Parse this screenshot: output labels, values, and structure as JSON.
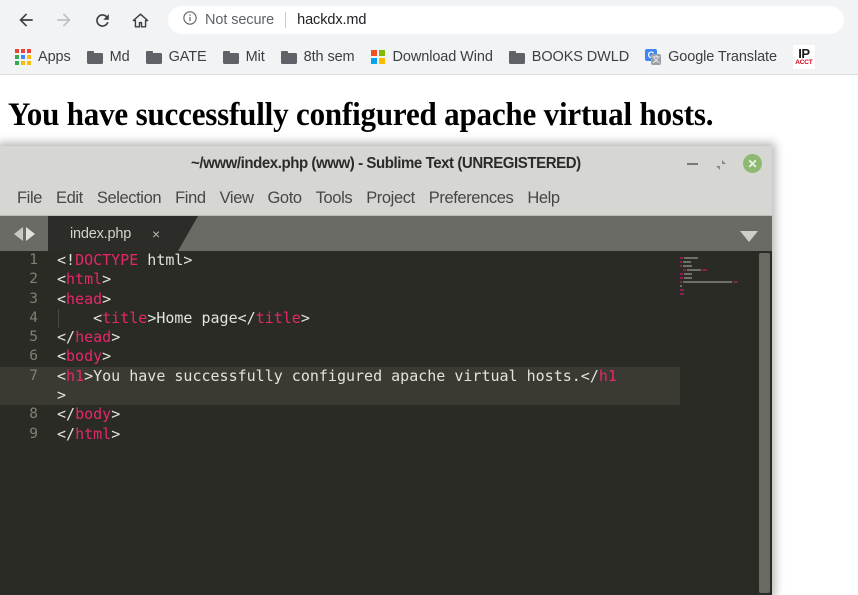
{
  "browser": {
    "toolbar": {
      "back_icon": "back-arrow-icon",
      "forward_icon": "forward-arrow-icon",
      "reload_icon": "reload-icon",
      "home_icon": "home-icon",
      "security_icon": "info-circle-icon",
      "security_label": "Not secure",
      "url": "hackdx.md"
    },
    "bookmarks": [
      {
        "label": "Apps",
        "icon": "apps-grid-icon"
      },
      {
        "label": "Md",
        "icon": "folder-icon"
      },
      {
        "label": "GATE",
        "icon": "folder-icon"
      },
      {
        "label": "Mit",
        "icon": "folder-icon"
      },
      {
        "label": "8th sem",
        "icon": "folder-icon"
      },
      {
        "label": "Download Wind",
        "icon": "windows-logo-icon"
      },
      {
        "label": "BOOKS DWLD",
        "icon": "folder-icon"
      },
      {
        "label": "Google Translate",
        "icon": "google-translate-icon"
      },
      {
        "label": "",
        "icon": "ip-acct-icon"
      }
    ]
  },
  "page": {
    "heading": "You have successfully configured apache virtual hosts."
  },
  "sublime": {
    "title": "~/www/index.php (www) - Sublime Text (UNREGISTERED)",
    "window_controls": {
      "minimize": "minimize-icon",
      "maximize": "maximize-icon",
      "close": "close-icon",
      "close_glyph": "✕"
    },
    "menu": [
      "File",
      "Edit",
      "Selection",
      "Find",
      "View",
      "Goto",
      "Tools",
      "Project",
      "Preferences",
      "Help"
    ],
    "tabs": [
      {
        "label": "index.php",
        "close_glyph": "×",
        "active": true
      }
    ],
    "editor": {
      "lines": [
        {
          "number": "1",
          "active": false,
          "indent_guide": false,
          "tokens": [
            {
              "t": "<!",
              "c": "punc"
            },
            {
              "t": "DOCTYPE",
              "c": "tag"
            },
            {
              "t": " html>",
              "c": "punc"
            }
          ]
        },
        {
          "number": "2",
          "active": false,
          "indent_guide": false,
          "tokens": [
            {
              "t": "<",
              "c": "punc"
            },
            {
              "t": "html",
              "c": "tag"
            },
            {
              "t": ">",
              "c": "punc"
            }
          ]
        },
        {
          "number": "3",
          "active": false,
          "indent_guide": false,
          "tokens": [
            {
              "t": "<",
              "c": "punc"
            },
            {
              "t": "head",
              "c": "tag"
            },
            {
              "t": ">",
              "c": "punc"
            }
          ]
        },
        {
          "number": "4",
          "active": false,
          "indent_guide": true,
          "tokens": [
            {
              "t": "    <",
              "c": "punc"
            },
            {
              "t": "title",
              "c": "tag"
            },
            {
              "t": ">Home page</",
              "c": "punc"
            },
            {
              "t": "title",
              "c": "tag"
            },
            {
              "t": ">",
              "c": "punc"
            }
          ]
        },
        {
          "number": "5",
          "active": false,
          "indent_guide": false,
          "tokens": [
            {
              "t": "</",
              "c": "punc"
            },
            {
              "t": "head",
              "c": "tag"
            },
            {
              "t": ">",
              "c": "punc"
            }
          ]
        },
        {
          "number": "6",
          "active": false,
          "indent_guide": false,
          "tokens": [
            {
              "t": "<",
              "c": "punc"
            },
            {
              "t": "body",
              "c": "tag"
            },
            {
              "t": ">",
              "c": "punc"
            }
          ]
        },
        {
          "number": "7",
          "active": true,
          "indent_guide": false,
          "tokens": [
            {
              "t": "<",
              "c": "punc"
            },
            {
              "t": "h1",
              "c": "tag"
            },
            {
              "t": ">You have successfully configured apache virtual hosts.</",
              "c": "punc"
            },
            {
              "t": "h1",
              "c": "tag"
            }
          ]
        },
        {
          "number": "",
          "active": true,
          "indent_guide": false,
          "tokens": [
            {
              "t": ">",
              "c": "punc"
            }
          ]
        },
        {
          "number": "8",
          "active": false,
          "indent_guide": false,
          "tokens": [
            {
              "t": "</",
              "c": "punc"
            },
            {
              "t": "body",
              "c": "tag"
            },
            {
              "t": ">",
              "c": "punc"
            }
          ]
        },
        {
          "number": "9",
          "active": false,
          "indent_guide": false,
          "tokens": [
            {
              "t": "</",
              "c": "punc"
            },
            {
              "t": "html",
              "c": "tag"
            },
            {
              "t": ">",
              "c": "punc"
            }
          ]
        }
      ],
      "minimap_rows": [
        {
          "y": 0,
          "segs": [
            {
              "x": 0,
              "w": 3,
              "color": "#8a2050"
            },
            {
              "x": 4,
              "w": 14,
              "color": "#6f6f68"
            }
          ]
        },
        {
          "y": 4,
          "segs": [
            {
              "x": 0,
              "w": 2,
              "color": "#8a2050"
            },
            {
              "x": 3,
              "w": 8,
              "color": "#6f6f68"
            }
          ]
        },
        {
          "y": 8,
          "segs": [
            {
              "x": 0,
              "w": 2,
              "color": "#8a2050"
            },
            {
              "x": 3,
              "w": 9,
              "color": "#6f6f68"
            }
          ]
        },
        {
          "y": 12,
          "segs": [
            {
              "x": 3,
              "w": 3,
              "color": "#8a2050"
            },
            {
              "x": 7,
              "w": 14,
              "color": "#6f6f68"
            },
            {
              "x": 22,
              "w": 5,
              "color": "#8a2050"
            }
          ]
        },
        {
          "y": 16,
          "segs": [
            {
              "x": 0,
              "w": 3,
              "color": "#8a2050"
            },
            {
              "x": 4,
              "w": 8,
              "color": "#6f6f68"
            }
          ]
        },
        {
          "y": 20,
          "segs": [
            {
              "x": 0,
              "w": 3,
              "color": "#8a2050"
            },
            {
              "x": 4,
              "w": 8,
              "color": "#6f6f68"
            }
          ]
        },
        {
          "y": 24,
          "segs": [
            {
              "x": 0,
              "w": 2,
              "color": "#8a2050"
            },
            {
              "x": 3,
              "w": 49,
              "color": "#6f6f68"
            },
            {
              "x": 53,
              "w": 5,
              "color": "#8a2050"
            }
          ]
        },
        {
          "y": 28,
          "segs": [
            {
              "x": 0,
              "w": 2,
              "color": "#6f6f68"
            }
          ]
        },
        {
          "y": 32,
          "segs": [
            {
              "x": 0,
              "w": 4,
              "color": "#8a2050"
            }
          ]
        },
        {
          "y": 36,
          "segs": [
            {
              "x": 0,
              "w": 4,
              "color": "#8a2050"
            }
          ]
        }
      ]
    }
  },
  "colors": {
    "browser_chrome": "#f1f3f4",
    "titlebar": "#d6d6d2",
    "tabbar": "#6b6b66",
    "editor_bg": "#2b2b26",
    "active_line": "#3a3a33",
    "tag_pink": "#e5276a",
    "code_text": "#e3e3dd",
    "gutter_text": "#857f72",
    "close_green": "#8fb972",
    "link_blue": "#4285f4"
  }
}
